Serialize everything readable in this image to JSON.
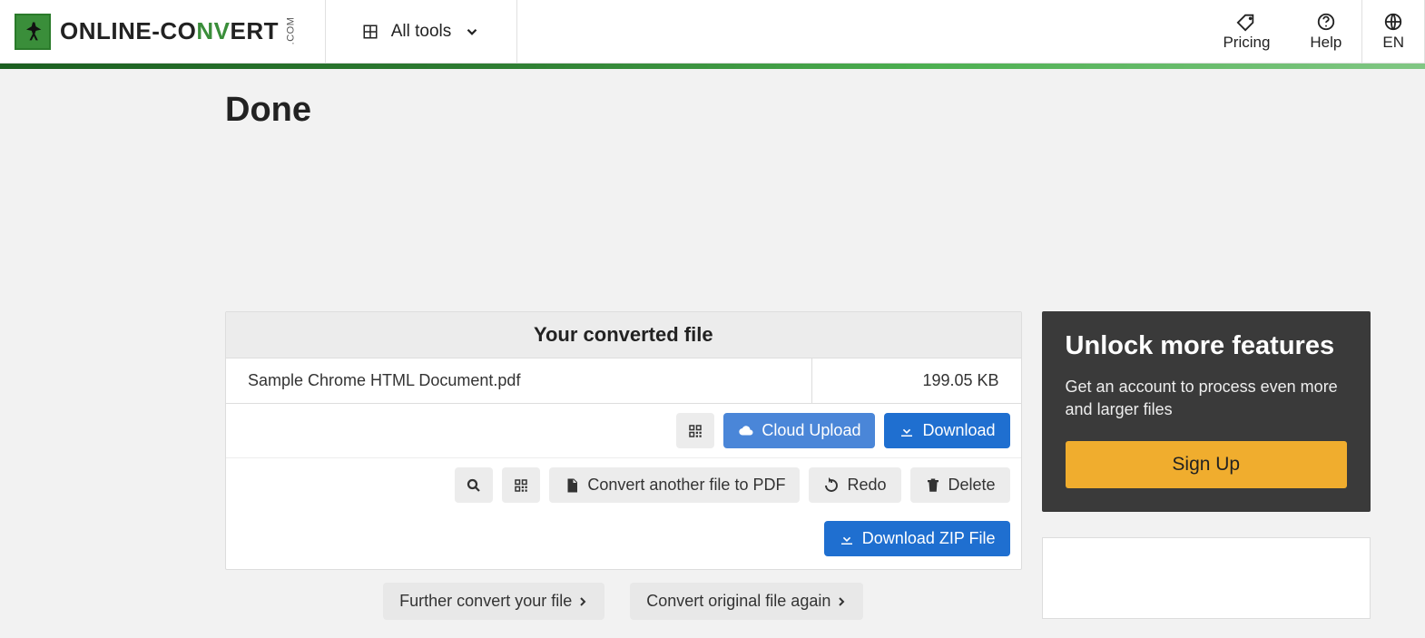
{
  "header": {
    "all_tools": "All tools",
    "pricing": "Pricing",
    "help": "Help",
    "lang": "EN"
  },
  "title": "Done",
  "panel": {
    "header": "Your converted file",
    "file_name": "Sample Chrome HTML Document.pdf",
    "file_size": "199.05 KB",
    "cloud_upload": "Cloud Upload",
    "download": "Download",
    "convert_another": "Convert another file to PDF",
    "redo": "Redo",
    "delete": "Delete",
    "download_zip": "Download ZIP File"
  },
  "footer": {
    "further": "Further convert your file",
    "again": "Convert original file again"
  },
  "promo": {
    "title": "Unlock more features",
    "text": "Get an account to process even more and larger files",
    "cta": "Sign Up"
  }
}
